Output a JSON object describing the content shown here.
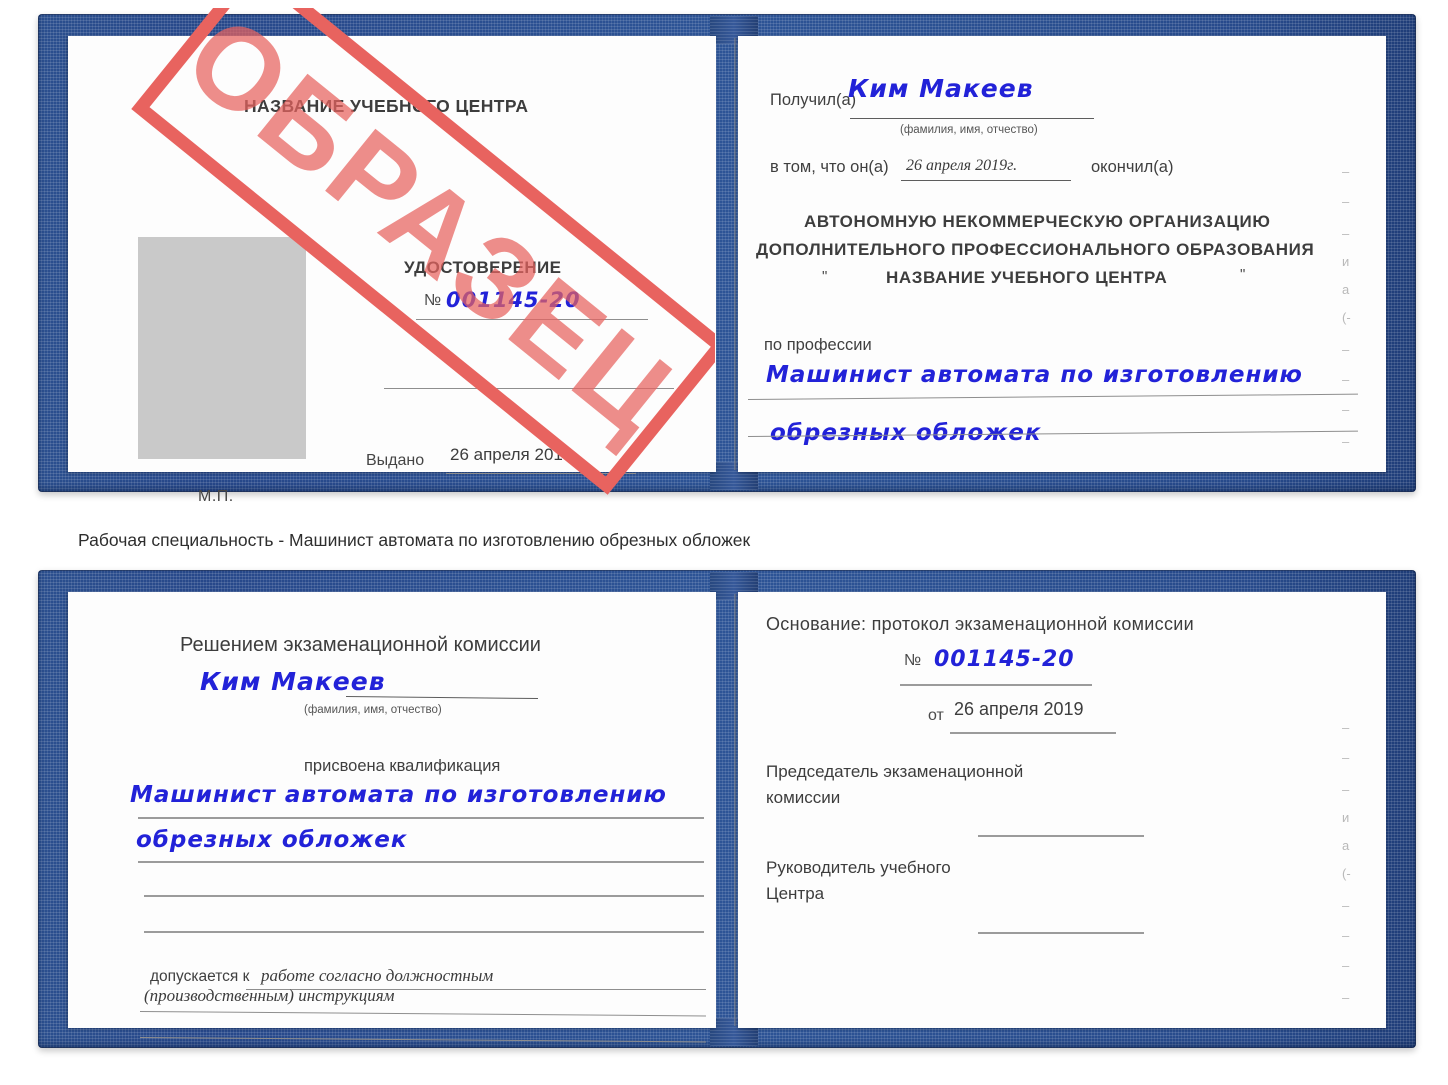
{
  "caption": "Рабочая специальность - Машинист автомата по изготовлению обрезных обложек",
  "stamp": {
    "text": "ОБРАЗЕЦ",
    "color": "#e8635f"
  },
  "colors": {
    "cover": "#2d5496",
    "handwriting": "#2222d8",
    "rule": "#8e8e8e"
  },
  "doc_top": {
    "left_page": {
      "title": "НАЗВАНИЕ УЧЕБНОГО ЦЕНТРА",
      "doc_type": "УДОСТОВЕРЕНИЕ",
      "number_label": "№",
      "number_value": "001145-20",
      "issued_label": "Выдано",
      "issued_value": "26 апреля 2019",
      "seal_label": "М.П."
    },
    "right_page": {
      "received_label": "Получил(а)",
      "received_value": "Ким Макеев",
      "fio_hint": "(фамилия, имя, отчество)",
      "that_he_label": "в том, что он(а)",
      "completion_date": "26 апреля 2019г.",
      "finished_label": "окончил(а)",
      "org_line1": "АВТОНОМНУЮ НЕКОММЕРЧЕСКУЮ ОРГАНИЗАЦИЮ",
      "org_line2": "ДОПОЛНИТЕЛЬНОГО ПРОФЕССИОНАЛЬНОГО ОБРАЗОВАНИЯ",
      "org_quote_open": "\"",
      "org_line3": "НАЗВАНИЕ УЧЕБНОГО ЦЕНТРА",
      "org_quote_close": "\"",
      "profession_label": "по профессии",
      "profession_line1": "Машинист автомата по изготовлению",
      "profession_line2": "обрезных обложек"
    }
  },
  "doc_bottom": {
    "left_page": {
      "decision_title": "Решением экзаменационной комиссии",
      "name_value": "Ким Макеев",
      "fio_hint": "(фамилия, имя, отчество)",
      "qualification_label": "присвоена квалификация",
      "qualification_line1": "Машинист автомата по изготовлению",
      "qualification_line2": "обрезных обложек",
      "admitted_label": "допускается к",
      "admitted_value_line1": "работе согласно должностным",
      "admitted_value_line2": "(производственным) инструкциям"
    },
    "right_page": {
      "basis_label": "Основание: протокол экзаменационной комиссии",
      "number_label": "№",
      "number_value": "001145-20",
      "date_label": "от",
      "date_value": "26 апреля 2019",
      "chairman_line1": "Председатель экзаменационной",
      "chairman_line2": "комиссии",
      "head_line1": "Руководитель учебного",
      "head_line2": "Центра"
    }
  },
  "margin_ghosts": [
    "–",
    "–",
    "–",
    "и",
    "а",
    "(-",
    "–",
    "–",
    "–",
    "–"
  ]
}
